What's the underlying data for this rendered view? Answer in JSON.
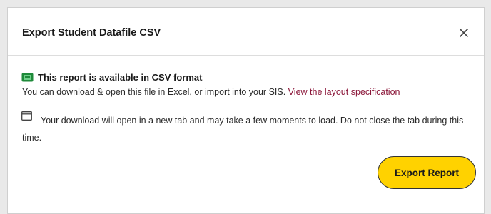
{
  "dialog": {
    "title": "Export Student Datafile CSV",
    "close_icon": "close-icon"
  },
  "availability": {
    "icon": "csv-file-icon",
    "heading": "This report is available in CSV format",
    "description": "You can download & open this file in Excel, or import into your SIS.",
    "link_text": "View the layout specification"
  },
  "download_note": {
    "icon": "new-tab-icon",
    "text": "Your download will open in a new tab and may take a few moments to load. Do not close the tab during this time."
  },
  "actions": {
    "export_label": "Export Report"
  },
  "colors": {
    "accent_button": "#ffd200",
    "link": "#8a1538",
    "csv_icon": "#1f8a3a"
  }
}
